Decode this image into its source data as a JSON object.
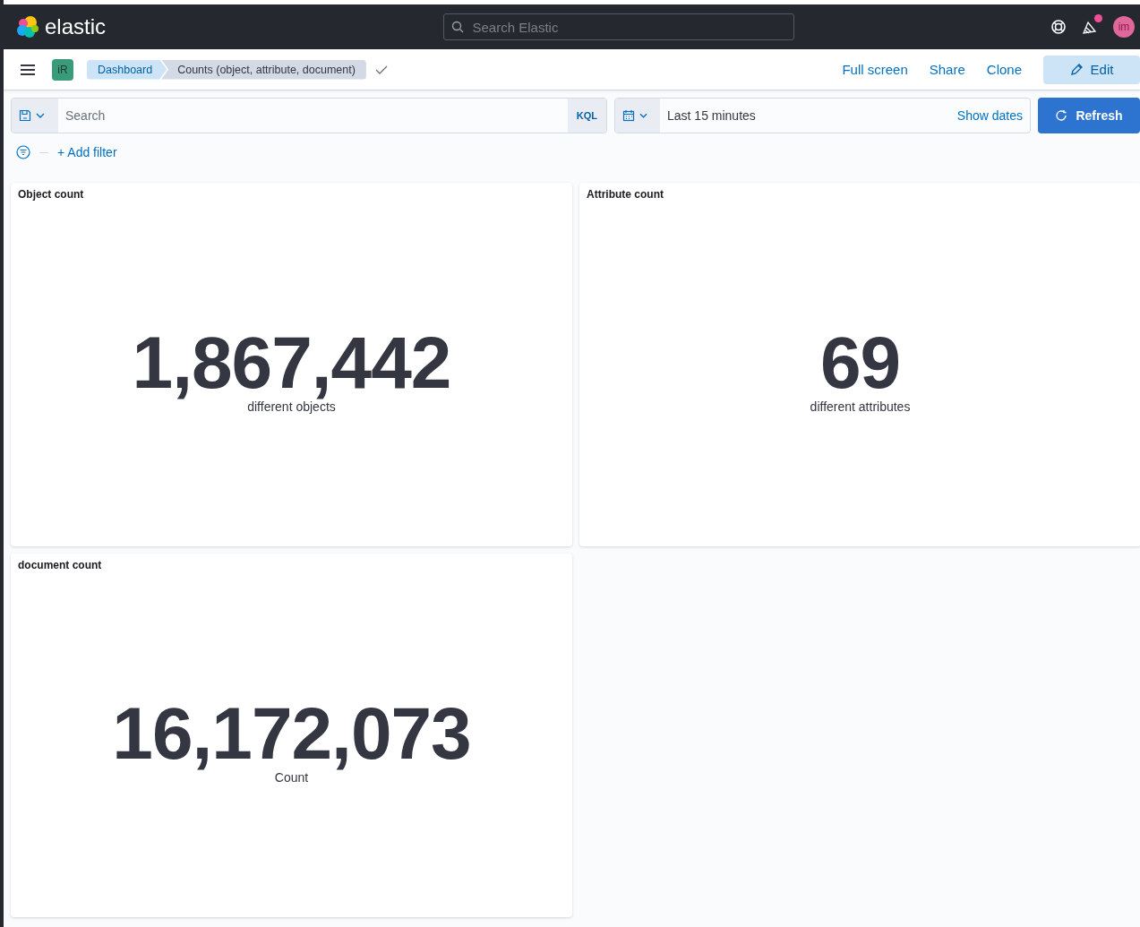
{
  "header": {
    "logo_text": "elastic",
    "search": {
      "placeholder": "Search Elastic"
    },
    "news_unread": true,
    "avatar": "im"
  },
  "nav": {
    "space": "iR",
    "breadcrumbs": [
      {
        "label": "Dashboard",
        "selected": false
      },
      {
        "label": "Counts (object, attribute, document)",
        "selected": true
      }
    ],
    "actions": [
      "Full screen",
      "Share",
      "Clone"
    ],
    "edit_button": "Edit"
  },
  "query": {
    "search": {
      "placeholder": "Search"
    },
    "language": "KQL",
    "time": "Last 15 minutes",
    "show_dates": "Show dates",
    "refresh": "Refresh"
  },
  "filters": {
    "add_filter": "+ Add filter"
  },
  "panels": [
    {
      "title": "Object count",
      "value": "1,867,442",
      "label": "different objects"
    },
    {
      "title": "Attribute count",
      "value": "69",
      "label": "different attributes"
    },
    {
      "title": "document count",
      "value": "16,172,073",
      "label": "Count"
    }
  ]
}
